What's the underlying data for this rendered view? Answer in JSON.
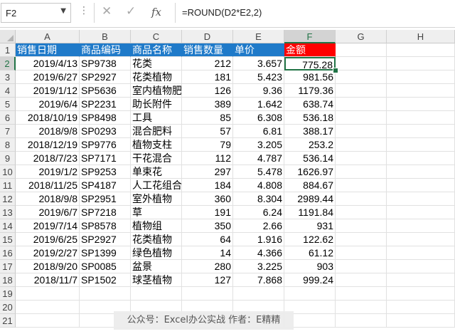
{
  "formula_bar": {
    "name_box": "F2",
    "vertical_dots": "⋮",
    "cancel_glyph": "✕",
    "enter_glyph": "✓",
    "fx_label": "fx",
    "formula": "=ROUND(D2*E2,2)"
  },
  "columns": [
    "A",
    "B",
    "C",
    "D",
    "E",
    "F",
    "G",
    "H"
  ],
  "rows": [
    "1",
    "2",
    "3",
    "4",
    "5",
    "6",
    "7",
    "8",
    "9",
    "10",
    "11",
    "12",
    "13",
    "14",
    "15",
    "16",
    "17",
    "18",
    "19",
    "20",
    "21"
  ],
  "header": [
    "销售日期",
    "商品编码",
    "商品名称",
    "销售数量",
    "单价",
    "金额"
  ],
  "table": [
    [
      "2019/4/13",
      "SP9738",
      "花类",
      "212",
      "3.657",
      "775.28"
    ],
    [
      "2019/6/27",
      "SP2927",
      "花类植物",
      "181",
      "5.423",
      "981.56"
    ],
    [
      "2019/1/12",
      "SP5636",
      "室内植物肥",
      "126",
      "9.36",
      "1179.36"
    ],
    [
      "2019/6/4",
      "SP2231",
      "助长附件",
      "389",
      "1.642",
      "638.74"
    ],
    [
      "2018/10/19",
      "SP8498",
      "工具",
      "85",
      "6.308",
      "536.18"
    ],
    [
      "2018/9/8",
      "SP0293",
      "混合肥料",
      "57",
      "6.81",
      "388.17"
    ],
    [
      "2018/12/19",
      "SP9776",
      "植物支柱",
      "79",
      "3.205",
      "253.2"
    ],
    [
      "2018/7/23",
      "SP7171",
      "干花混合",
      "112",
      "4.787",
      "536.14"
    ],
    [
      "2019/1/2",
      "SP9253",
      "单束花",
      "297",
      "5.478",
      "1626.97"
    ],
    [
      "2018/11/25",
      "SP4187",
      "人工花组合",
      "184",
      "4.808",
      "884.67"
    ],
    [
      "2018/9/8",
      "SP2951",
      "室外植物",
      "360",
      "8.304",
      "2989.44"
    ],
    [
      "2019/6/7",
      "SP7218",
      "草",
      "191",
      "6.24",
      "1191.84"
    ],
    [
      "2019/7/14",
      "SP8578",
      "植物组",
      "350",
      "2.66",
      "931"
    ],
    [
      "2019/6/25",
      "SP2927",
      "花类植物",
      "64",
      "1.916",
      "122.62"
    ],
    [
      "2019/2/27",
      "SP1399",
      "绿色植物",
      "14",
      "4.366",
      "61.12"
    ],
    [
      "2018/9/20",
      "SP0085",
      "盆景",
      "280",
      "3.225",
      "903"
    ],
    [
      "2018/11/7",
      "SP1502",
      "球茎植物",
      "127",
      "7.868",
      "999.24"
    ]
  ],
  "watermark": "公众号：Excel办公实战 作者：E精精",
  "colors": {
    "header_blue": "#1f7ac9",
    "header_red": "#ff0000",
    "selection_green": "#217346"
  }
}
